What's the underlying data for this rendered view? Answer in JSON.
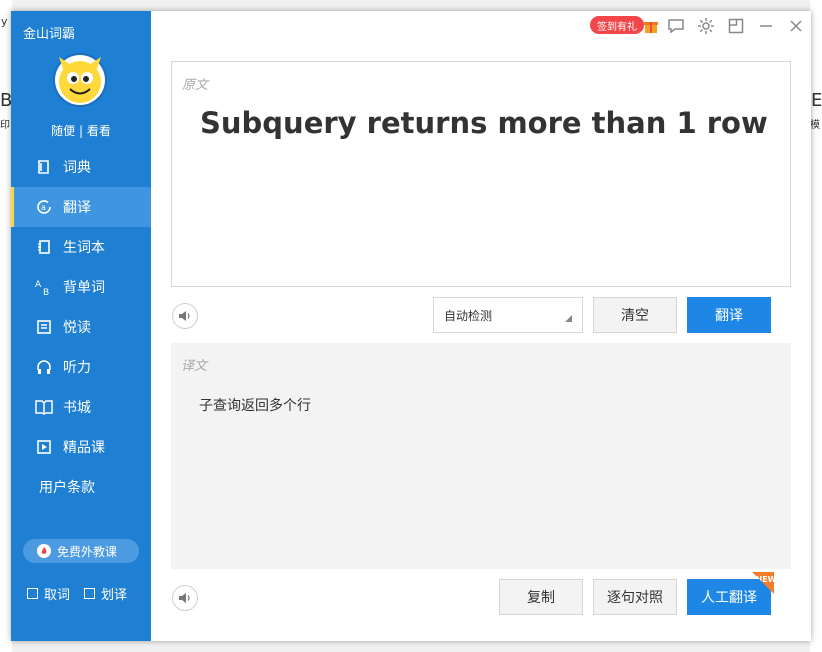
{
  "background": {
    "left_fragments": [
      "y",
      "B",
      "印"
    ],
    "right_fragments": [
      "E",
      "模"
    ]
  },
  "app": {
    "title": "金山词霸",
    "slogan": "随便 | 看看"
  },
  "nav": [
    {
      "label": "词典",
      "icon": "dictionary-icon"
    },
    {
      "label": "翻译",
      "icon": "translate-icon",
      "active": true
    },
    {
      "label": "生词本",
      "icon": "wordbook-icon"
    },
    {
      "label": "背单词",
      "icon": "memorize-icon"
    },
    {
      "label": "悦读",
      "icon": "reading-icon"
    },
    {
      "label": "听力",
      "icon": "headphones-icon"
    },
    {
      "label": "书城",
      "icon": "bookstore-icon"
    },
    {
      "label": "精品课",
      "icon": "video-course-icon"
    },
    {
      "label": "用户条款",
      "icon": ""
    }
  ],
  "promo": {
    "label": "免费外教课"
  },
  "checks": [
    {
      "label": "取词"
    },
    {
      "label": "划译"
    }
  ],
  "topbar": {
    "badge": "签到有礼"
  },
  "source": {
    "placeholder": "原文",
    "text": "Subquery returns more than 1 row"
  },
  "controls": {
    "lang_select": "自动检测",
    "clear": "清空",
    "translate": "翻译"
  },
  "result": {
    "placeholder": "译文",
    "text": "子查询返回多个行"
  },
  "actions": {
    "copy": "复制",
    "sentence_compare": "逐句对照",
    "human_translate": "人工翻译",
    "new_tag": "NEW"
  },
  "colors": {
    "sidebar": "#1e7fd3",
    "accent": "#1e87e6",
    "active": "#3f95e0",
    "indicator": "#ffd53d",
    "badge": "#f1474b"
  }
}
